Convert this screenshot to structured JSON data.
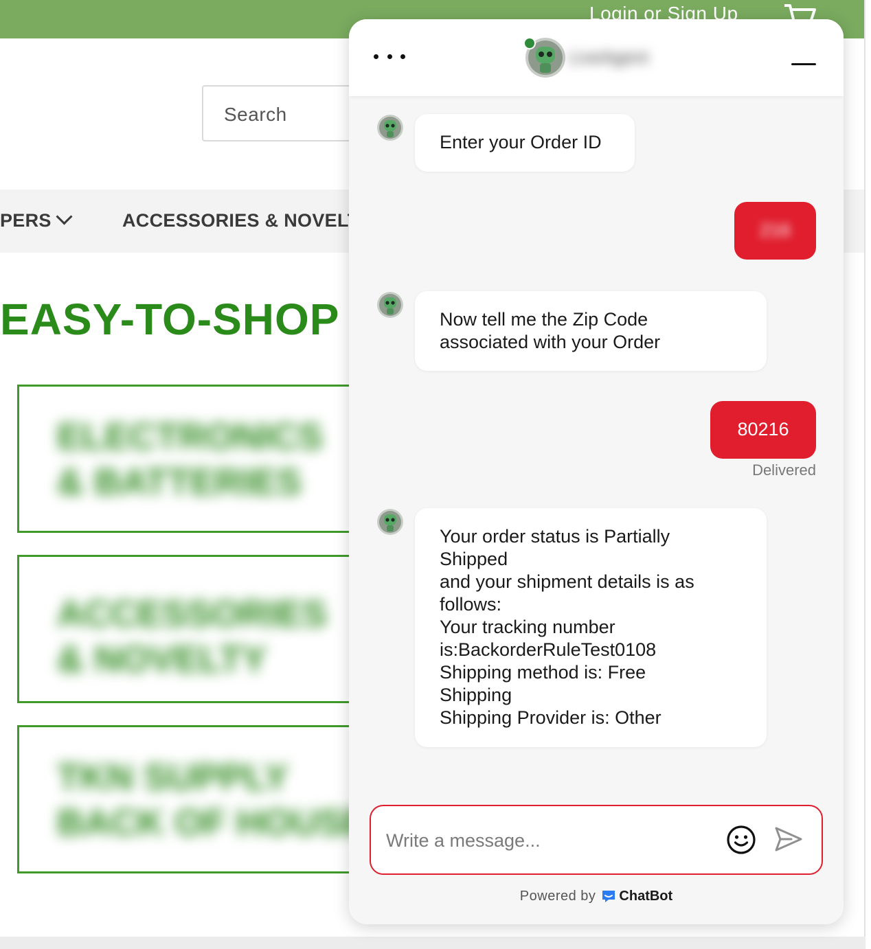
{
  "site": {
    "header": {
      "login_label": "Login or Sign Up",
      "cart_icon": "cart-icon",
      "bar_color": "#7aab5f"
    },
    "search": {
      "placeholder": "Search"
    },
    "nav": {
      "items": [
        {
          "label": "PERS"
        },
        {
          "label": "ACCESSORIES & NOVELT"
        }
      ]
    },
    "title": "EASY-TO-SHOP",
    "categories": [
      {
        "label": "ELECTRONICS\n& BATTERIES"
      },
      {
        "label": "ACCESSORIES\n& NOVELTY"
      },
      {
        "label": "TKN SUPPLY\nBACK OF HOUSE"
      }
    ]
  },
  "chat": {
    "header": {
      "menu_icon": "more-dots-icon",
      "agent_name": "LiveAgent",
      "online": true,
      "minimize_icon": "minimize-icon"
    },
    "messages": [
      {
        "from": "bot",
        "text": "Enter your Order ID"
      },
      {
        "from": "user",
        "text": "216",
        "blurred": true
      },
      {
        "from": "bot",
        "text": "Now tell me the Zip Code\nassociated with your Order"
      },
      {
        "from": "user",
        "text": "80216",
        "status": "Delivered"
      },
      {
        "from": "bot",
        "text": "Your order status is Partially\nShipped\nand your shipment details is as\nfollows:\nYour tracking number\nis:BackorderRuleTest0108\nShipping method is: Free\nShipping\nShipping Provider is: Other"
      }
    ],
    "composer": {
      "placeholder": "Write a message...",
      "value": ""
    },
    "footer": {
      "powered_by": "Powered by",
      "brand": "ChatBot"
    },
    "colors": {
      "user_bubble": "#e01e2e",
      "accent_border": "#e01e2e",
      "brand_blue": "#2b7bf3"
    }
  }
}
